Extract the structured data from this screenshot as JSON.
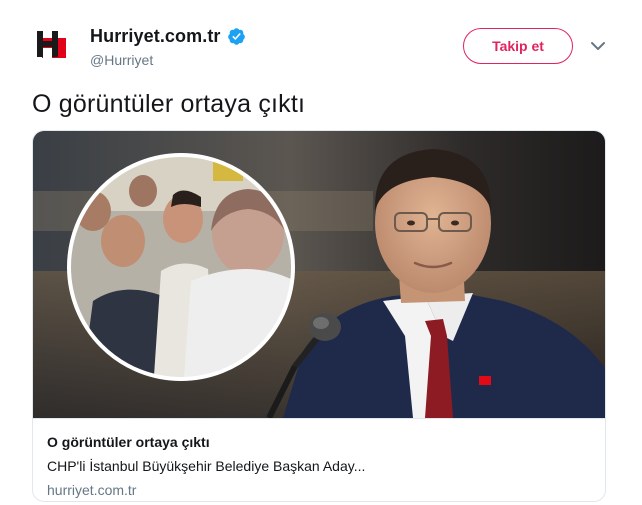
{
  "header": {
    "display_name": "Hurriyet.com.tr",
    "handle": "@Hurriyet",
    "verified": true,
    "follow_label": "Takip et",
    "avatar_icon": "hurriyet-logo-icon",
    "menu_icon": "chevron-down-icon"
  },
  "tweet": {
    "text": "O görüntüler ortaya çıktı"
  },
  "card": {
    "title": "O görüntüler ortaya çıktı",
    "description": "CHP'li İstanbul Büyükşehir Belediye Başkan Aday...",
    "domain": "hurriyet.com.tr"
  },
  "colors": {
    "follow_accent": "#e0245e",
    "verified_blue": "#1da1f2",
    "secondary_text": "#657786",
    "border": "#e1e8ed",
    "logo_red": "#e2001a"
  }
}
